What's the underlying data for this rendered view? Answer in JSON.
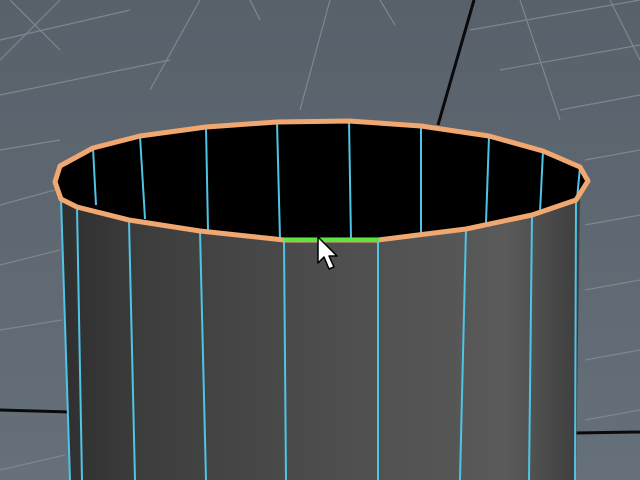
{
  "viewport": {
    "mode": "perspective",
    "background_color": "#5f6870",
    "grid_color": "#7d878f",
    "axis_line_color": "#0a0a0a"
  },
  "mesh": {
    "type": "cylinder",
    "subdivisions_visible": 12,
    "face_color": "#4a4a4a",
    "edge_color": "#4fc3e8",
    "selected_edge_loop_color": "#f0a770",
    "preselected_edge_color": "#5ee640"
  },
  "cursor": {
    "type": "arrow-pointer"
  }
}
